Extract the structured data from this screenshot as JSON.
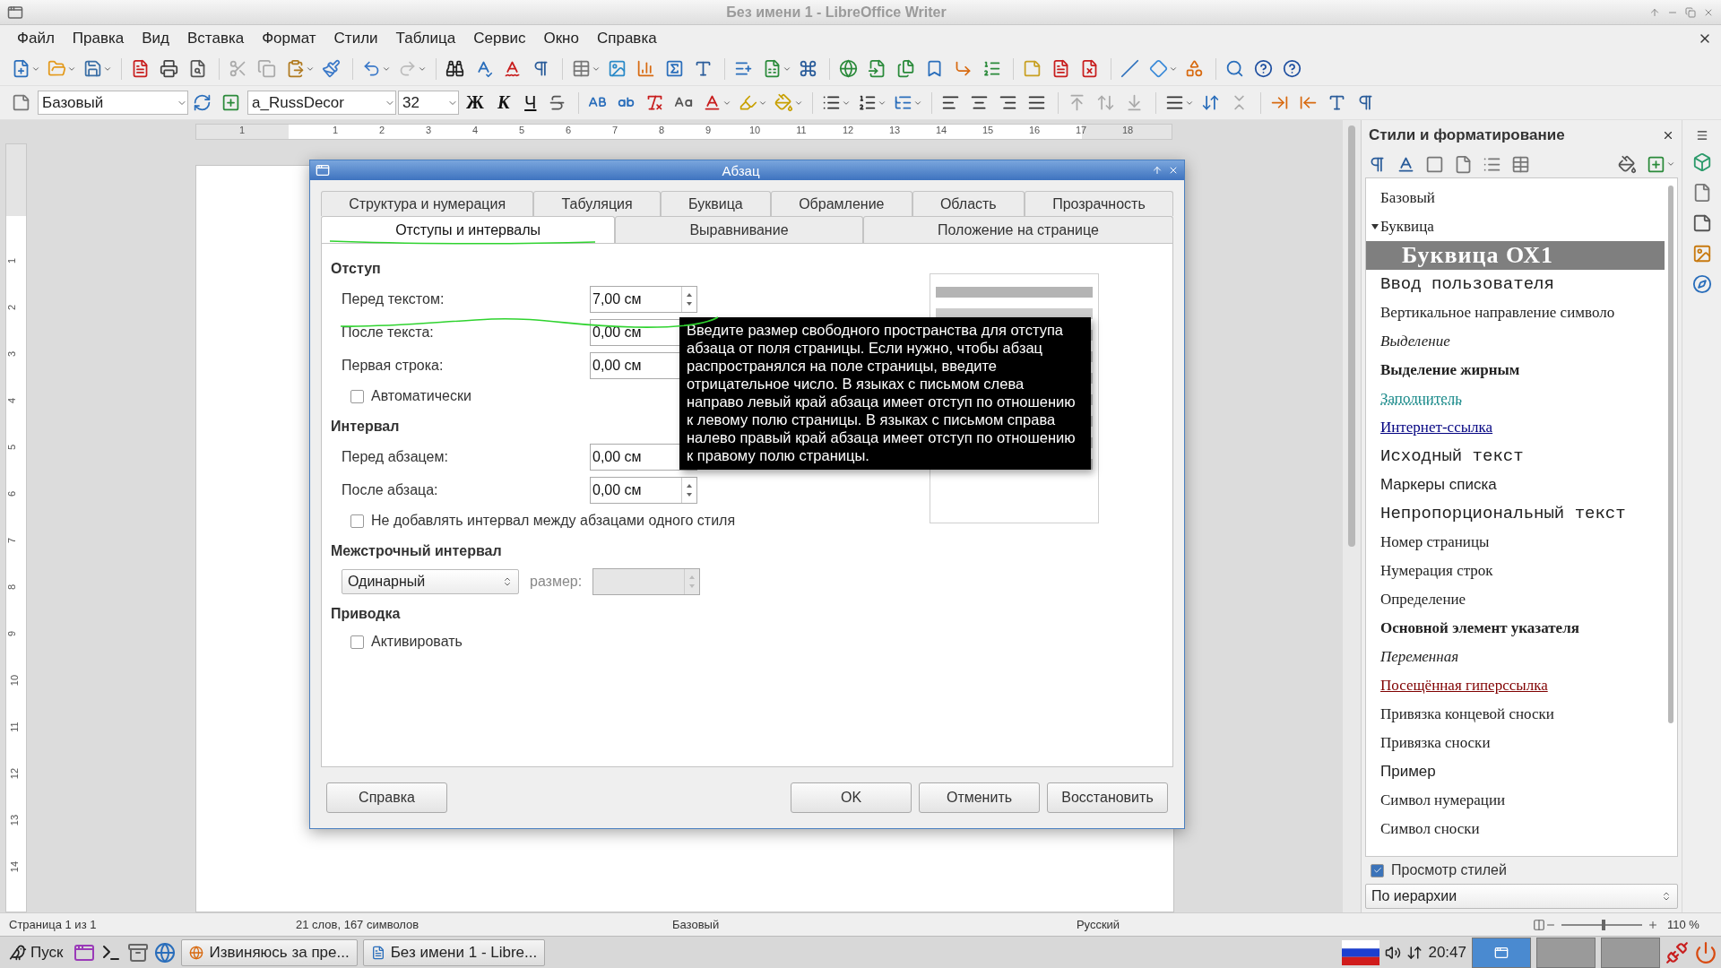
{
  "window": {
    "title": "Без имени 1 - LibreOffice Writer"
  },
  "menu": [
    "Файл",
    "Правка",
    "Вид",
    "Вставка",
    "Формат",
    "Стили",
    "Таблица",
    "Сервис",
    "Окно",
    "Справка"
  ],
  "formatting": {
    "style": "Базовый",
    "font": "a_RussDecor",
    "size": "32",
    "text_buttons": [
      "Ж",
      "К",
      "Ч"
    ]
  },
  "ruler": {
    "horizontal": [
      "1",
      "1",
      "2",
      "3",
      "4",
      "5",
      "6",
      "7",
      "8",
      "9",
      "10",
      "11",
      "12",
      "13",
      "14",
      "15",
      "16",
      "17",
      "18"
    ],
    "vertical": [
      "1",
      "2",
      "3",
      "4",
      "5",
      "6",
      "7",
      "8",
      "9",
      "10",
      "11",
      "12",
      "13",
      "14"
    ]
  },
  "dialog": {
    "title": "Абзац",
    "tab_rows": [
      [
        {
          "label": "Структура и нумерация",
          "selected": false
        },
        {
          "label": "Табуляция",
          "selected": false
        },
        {
          "label": "Буквица",
          "selected": false
        },
        {
          "label": "Обрамление",
          "selected": false
        },
        {
          "label": "Область",
          "selected": false
        },
        {
          "label": "Прозрачность",
          "selected": false
        }
      ],
      [
        {
          "label": "Отступы и интервалы",
          "selected": true
        },
        {
          "label": "Выравнивание",
          "selected": false
        },
        {
          "label": "Положение на странице",
          "selected": false
        }
      ]
    ],
    "sections": [
      {
        "title": "Отступ",
        "rows": [
          {
            "kind": "spin",
            "label": "Перед текстом:",
            "value": "7,00 см"
          },
          {
            "kind": "spin",
            "label": "После текста:",
            "value": "0,00 см"
          },
          {
            "kind": "spin",
            "label": "Первая строка:",
            "value": "0,00 см"
          },
          {
            "kind": "check",
            "label": "Автоматически",
            "checked": false
          }
        ]
      },
      {
        "title": "Интервал",
        "rows": [
          {
            "kind": "spin",
            "label": "Перед абзацем:",
            "value": "0,00 см"
          },
          {
            "kind": "spin",
            "label": "После абзаца:",
            "value": "0,00 см"
          },
          {
            "kind": "check",
            "label": "Не добавлять интервал между абзацами одного стиля",
            "checked": false
          }
        ]
      },
      {
        "title": "Межстрочный интервал",
        "rows": [
          {
            "kind": "select",
            "value": "Одинарный",
            "size_label": "размер:",
            "disabled": true
          }
        ]
      },
      {
        "title": "Приводка",
        "rows": [
          {
            "kind": "check",
            "label": "Активировать",
            "checked": false
          }
        ]
      }
    ],
    "tooltip": "Введите размер свободного пространства для отступа абзаца от поля страницы. Если нужно, чтобы абзац распространялся на поле страницы, введите отрицательное число. В языках с письмом слева направо левый край абзаца имеет отступ по отношению к левому полю страницы. В языках с письмом справа налево правый край абзаца имеет отступ по отношению к правому полю страницы.",
    "buttons": [
      {
        "kind": "help",
        "label": "Справка"
      },
      {
        "kind": "ok",
        "label": "OK"
      },
      {
        "kind": "cancel",
        "label": "Отменить"
      },
      {
        "kind": "reset",
        "label": "Восстановить"
      }
    ]
  },
  "sidebar": {
    "title": "Стили и форматирование",
    "styles": [
      {
        "label": "Базовый",
        "kind": "serif",
        "selected": false
      },
      {
        "label": "Буквица",
        "kind": "serif",
        "selected": false,
        "expanded": true,
        "children": [
          {
            "label": "Буквица ОХ1",
            "kind": "decor",
            "selected": true
          }
        ]
      },
      {
        "label": "Ввод пользователя",
        "kind": "mono",
        "selected": false
      },
      {
        "label": "Вертикальное направление символо",
        "kind": "serif",
        "selected": false
      },
      {
        "label": "Выделение",
        "kind": "italic",
        "selected": false
      },
      {
        "label": "Выделение жирным",
        "kind": "bold",
        "selected": false
      },
      {
        "label": "Заполнитель",
        "kind": "placeholder",
        "selected": false
      },
      {
        "label": "Интернет-ссылка",
        "kind": "link",
        "selected": false
      },
      {
        "label": "Исходный текст",
        "kind": "mono",
        "selected": false
      },
      {
        "label": "Маркеры списка",
        "kind": "sans",
        "selected": false
      },
      {
        "label": "Непропорциональный текст",
        "kind": "mono",
        "selected": false
      },
      {
        "label": "Номер страницы",
        "kind": "serif",
        "selected": false
      },
      {
        "label": "Нумерация строк",
        "kind": "serif",
        "selected": false
      },
      {
        "label": "Определение",
        "kind": "serif",
        "selected": false
      },
      {
        "label": "Основной элемент указателя",
        "kind": "bold",
        "selected": false
      },
      {
        "label": "Переменная",
        "kind": "italic",
        "selected": false
      },
      {
        "label": "Посещённая гиперссылка",
        "kind": "visited",
        "selected": false
      },
      {
        "label": "Привязка концевой сноски",
        "kind": "serif",
        "selected": false
      },
      {
        "label": "Привязка сноски",
        "kind": "serif",
        "selected": false
      },
      {
        "label": "Пример",
        "kind": "sans",
        "selected": false
      },
      {
        "label": "Символ нумерации",
        "kind": "serif",
        "selected": false
      },
      {
        "label": "Символ сноски",
        "kind": "serif",
        "selected": false
      }
    ],
    "preview": {
      "label": "Просмотр стилей",
      "checked": true
    },
    "filter": "По иерархии"
  },
  "status_bar": {
    "page": "Страница 1 из 1",
    "words": "21 слов, 167 символов",
    "style": "Базовый",
    "language": "Русский",
    "zoom": "110 %",
    "level": 0.5
  },
  "taskbar": {
    "start": "Пуск",
    "tasks": [
      "Извиняюсь за пре...",
      "Без имени 1 - Libre..."
    ],
    "clock": "20:47"
  }
}
